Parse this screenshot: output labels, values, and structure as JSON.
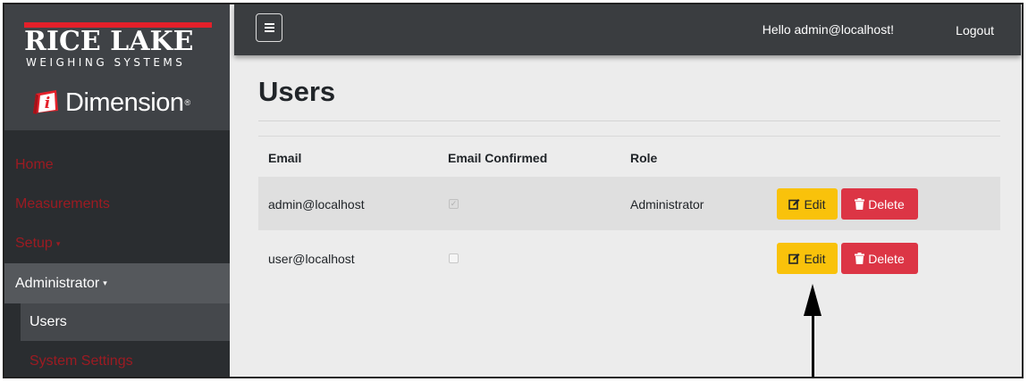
{
  "brand": {
    "company_name": "RICE LAKE",
    "company_tagline": "WEIGHING SYSTEMS",
    "product_name": "Dimension",
    "product_mark": "®",
    "product_badge_letter": "i"
  },
  "sidebar": {
    "items": [
      {
        "label": "Home"
      },
      {
        "label": "Measurements"
      },
      {
        "label": "Setup",
        "caret": "▾"
      },
      {
        "label": "Administrator",
        "caret": "▾"
      },
      {
        "label": "Users"
      },
      {
        "label": "System Settings"
      }
    ]
  },
  "topbar": {
    "menu_icon": "hamburger-icon",
    "greeting": "Hello admin@localhost!",
    "logout_label": "Logout"
  },
  "main": {
    "title": "Users",
    "table": {
      "headers": [
        "Email",
        "Email Confirmed",
        "Role"
      ],
      "rows": [
        {
          "email": "admin@localhost",
          "confirmed": true,
          "role": "Administrator",
          "edit_label": "Edit",
          "delete_label": "Delete"
        },
        {
          "email": "user@localhost",
          "confirmed": false,
          "role": "",
          "edit_label": "Edit",
          "delete_label": "Delete"
        }
      ]
    }
  },
  "colors": {
    "sidebar_bg": "#2a2d30",
    "topbar_bg": "#3a3d40",
    "nav_link": "#9c1b22",
    "edit_button": "#f9c20b",
    "delete_button": "#dc3545",
    "brand_red": "#e4202a"
  },
  "annotation": {
    "pointer": "arrow-up-icon"
  }
}
